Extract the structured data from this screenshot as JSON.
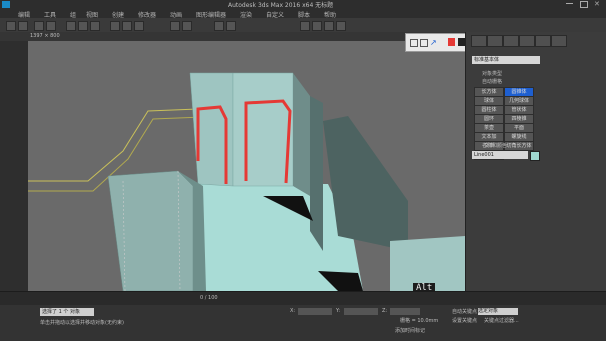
{
  "window": {
    "title": "Autodesk 3ds Max 2016 x64     无标题"
  },
  "menu": {
    "items": [
      "编辑",
      "工具",
      "组",
      "视图",
      "创建",
      "修改器",
      "动画",
      "图形编辑器",
      "渲染",
      "自定义",
      "脚本",
      "帮助"
    ]
  },
  "viewport": {
    "label": "1397 × 800",
    "alt_indicator": "Alt"
  },
  "command_panel": {
    "category": "标准基本体",
    "rollout_object_type": "对象类型",
    "autogrid_label": "自动栅格",
    "objects": [
      "长方体",
      "圆锥体",
      "球体",
      "几何球体",
      "圆柱体",
      "管状体",
      "圆环",
      "四棱锥",
      "茶壶",
      "平面",
      "文本加",
      "螺旋线",
      "文本",
      "切角长方体",
      "平面"
    ],
    "rollout_name_color": "名称和颜色",
    "name_value": "Line001",
    "color_swatch": "#9fd8d0"
  },
  "timeline": {
    "frame_range": "0 / 100"
  },
  "status": {
    "line1": "选择了 1 个 对象",
    "line2": "单击并拖动以选择并移动对象(无约束)",
    "x_label": "X:",
    "y_label": "Y:",
    "z_label": "Z:",
    "grid_label": "栅格 = 10.0mm",
    "add_time_tag": "添加时间标记",
    "auto_key_label": "自动关键点",
    "selected_dropdown": "选定对象",
    "set_key_label": "设置关键点",
    "key_filters_label": "关键点过滤器..."
  },
  "colors": {
    "accent": "#e53935",
    "floor": "#a9dcd6",
    "wall_light": "#9ec5c1",
    "wall_dark": "#4d6361",
    "panel": "#3c3c3c"
  }
}
